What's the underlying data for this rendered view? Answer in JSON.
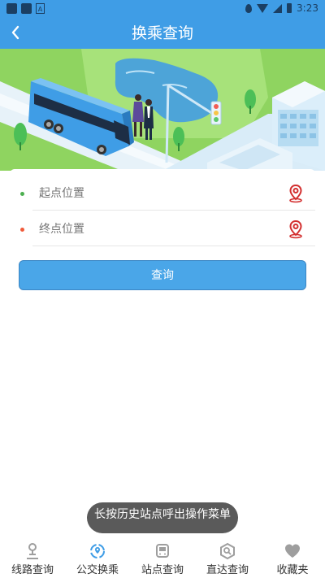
{
  "status_bar": {
    "time": "3:23"
  },
  "header": {
    "title": "换乘查询",
    "back_icon": "back-chevron-icon"
  },
  "form": {
    "start_placeholder": "起点位置",
    "end_placeholder": "终点位置",
    "start_dot_color": "#4caf50",
    "end_dot_color": "#f05a3a",
    "pin_icon": "location-pin-icon",
    "pin_color": "#d32f2f"
  },
  "query_button": {
    "label": "查询",
    "color": "#4aa6e8"
  },
  "toast": {
    "text": "长按历史站点呼出操作菜单"
  },
  "bottom_nav": {
    "items": [
      {
        "label": "线路查询",
        "icon": "route-icon"
      },
      {
        "label": "公交换乘",
        "icon": "transfer-icon",
        "active": true
      },
      {
        "label": "站点查询",
        "icon": "bus-stop-icon"
      },
      {
        "label": "直达查询",
        "icon": "direct-search-icon"
      },
      {
        "label": "收藏夹",
        "icon": "heart-icon"
      }
    ],
    "active_color": "#3f9de6",
    "inactive_color": "#9e9e9e"
  },
  "colors": {
    "primary": "#3f9de6"
  }
}
